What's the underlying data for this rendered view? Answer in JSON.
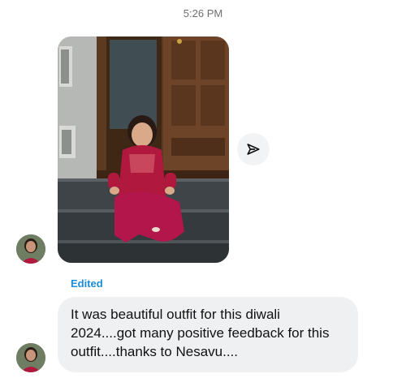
{
  "status": {
    "time": "5:26 PM"
  },
  "conversation": {
    "photo_message": {
      "icon": "photo-attachment",
      "share_icon": "send-arrow-icon"
    },
    "edited_label": "Edited",
    "text_message": "It was beautiful outfit for this diwali 2024....got many positive feedback for this outfit....thanks to Nesavu....",
    "avatar_icon": "user-avatar"
  },
  "colors": {
    "accent": "#1a8cd8",
    "bubble": "#eff0f2",
    "share_button_bg": "#f2f3f5",
    "timestamp": "#6e6e6e"
  }
}
